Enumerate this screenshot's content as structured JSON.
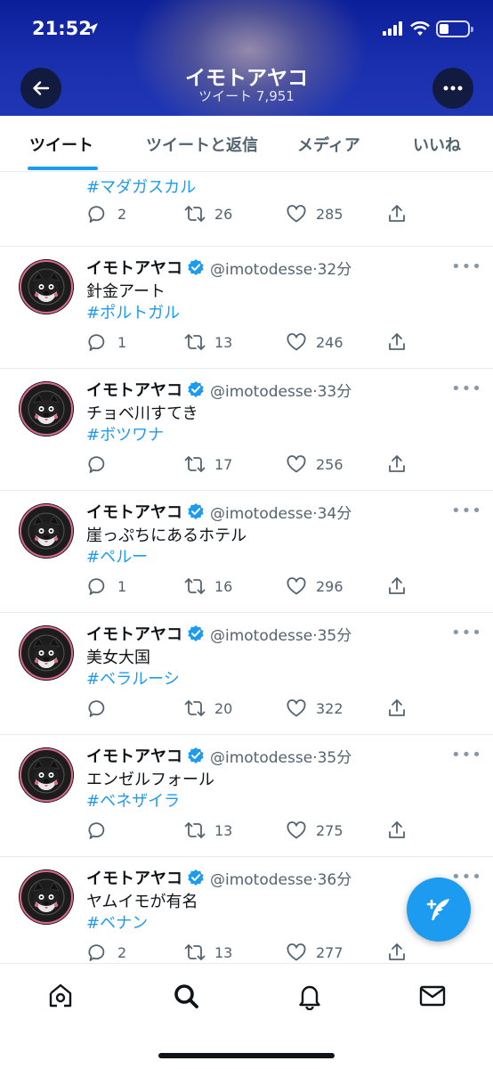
{
  "status_bar": {
    "time": "21:52"
  },
  "header": {
    "title": "イモトアヤコ",
    "subtitle": "ツイート 7,951",
    "back_icon": "arrow-left-icon",
    "more_icon": "more-horizontal-icon"
  },
  "tabs": [
    {
      "label": "ツイート",
      "active": true
    },
    {
      "label": "ツイートと返信",
      "active": false
    },
    {
      "label": "メディア",
      "active": false
    },
    {
      "label": "いいね",
      "active": false
    }
  ],
  "partial_tweet": {
    "hashtag": "#マダガスカル",
    "replies": "2",
    "retweets": "26",
    "likes": "285"
  },
  "tweets": [
    {
      "name": "イモトアヤコ",
      "handle": "@imotodesse",
      "time": "32分",
      "text": "針金アート",
      "hashtag": "#ポルトガル",
      "replies": "1",
      "retweets": "13",
      "likes": "246"
    },
    {
      "name": "イモトアヤコ",
      "handle": "@imotodesse",
      "time": "33分",
      "text": "チョベ川すてき",
      "hashtag": "#ボツワナ",
      "replies": "",
      "retweets": "17",
      "likes": "256"
    },
    {
      "name": "イモトアヤコ",
      "handle": "@imotodesse",
      "time": "34分",
      "text": "崖っぷちにあるホテル",
      "hashtag": "#ペルー",
      "replies": "1",
      "retweets": "16",
      "likes": "296"
    },
    {
      "name": "イモトアヤコ",
      "handle": "@imotodesse",
      "time": "35分",
      "text": "美女大国",
      "hashtag": "#ベラルーシ",
      "replies": "",
      "retweets": "20",
      "likes": "322"
    },
    {
      "name": "イモトアヤコ",
      "handle": "@imotodesse",
      "time": "35分",
      "text": "エンゼルフォール",
      "hashtag": "#ベネザイラ",
      "replies": "",
      "retweets": "13",
      "likes": "275"
    },
    {
      "name": "イモトアヤコ",
      "handle": "@imotodesse",
      "time": "36分",
      "text": "ヤムイモが有名",
      "hashtag": "#ベナン",
      "replies": "2",
      "retweets": "13",
      "likes": "277"
    }
  ],
  "bottom_nav": [
    {
      "icon": "home-icon"
    },
    {
      "icon": "search-icon"
    },
    {
      "icon": "notifications-bell-icon"
    },
    {
      "icon": "messages-envelope-icon"
    }
  ],
  "colors": {
    "accent": "#1d9bf0",
    "header_bg": "#1a2fae",
    "text_secondary": "#536471"
  }
}
